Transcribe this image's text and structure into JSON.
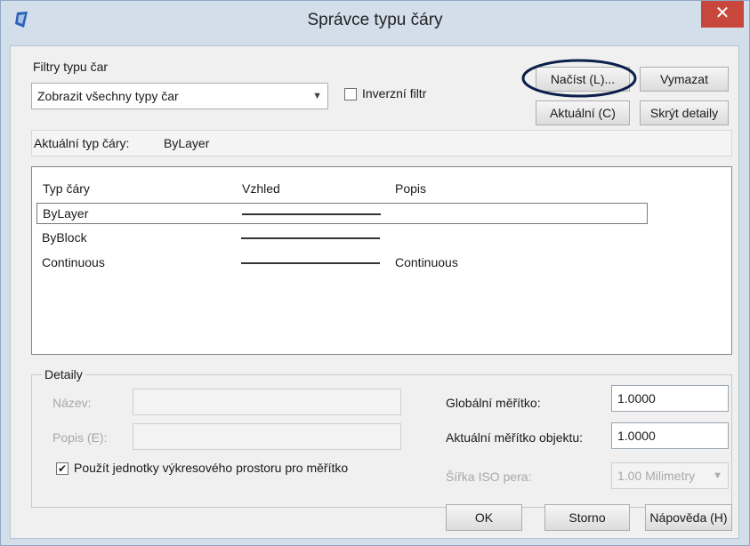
{
  "window": {
    "title": "Správce typu čáry",
    "close_glyph": "✕"
  },
  "filters": {
    "group_label": "Filtry typu čar",
    "selected": "Zobrazit všechny typy čar",
    "inverse_label": "Inverzní filtr",
    "inverse_checked": false
  },
  "buttons": {
    "load": "Načíst (L)...",
    "delete": "Vymazat",
    "current": "Aktuální (C)",
    "hide_details": "Skrýt detaily",
    "ok": "OK",
    "cancel": "Storno",
    "help": "Nápověda (H)"
  },
  "current_linetype": {
    "label": "Aktuální typ čáry:",
    "value": "ByLayer"
  },
  "table": {
    "headers": [
      "Typ čáry",
      "Vzhled",
      "Popis"
    ],
    "rows": [
      {
        "name": "ByLayer",
        "description": "",
        "selected": true
      },
      {
        "name": "ByBlock",
        "description": "",
        "selected": false
      },
      {
        "name": "Continuous",
        "description": "Continuous",
        "selected": false
      }
    ]
  },
  "details": {
    "group_label": "Detaily",
    "name_label": "Název:",
    "name_value": "",
    "desc_label": "Popis (E):",
    "desc_value": "",
    "global_scale_label": "Globální měřítko:",
    "global_scale_value": "1.0000",
    "object_scale_label": "Aktuální měřítko objektu:",
    "object_scale_value": "1.0000",
    "iso_pen_label": "Šířka ISO pera:",
    "iso_pen_value": "1.00 Milimetry",
    "paper_space_label": "Použít jednotky výkresového prostoru pro měřítko",
    "paper_space_checked": true
  },
  "colors": {
    "highlight_ellipse": "#0b1f4a",
    "close_button": "#c8473c"
  }
}
